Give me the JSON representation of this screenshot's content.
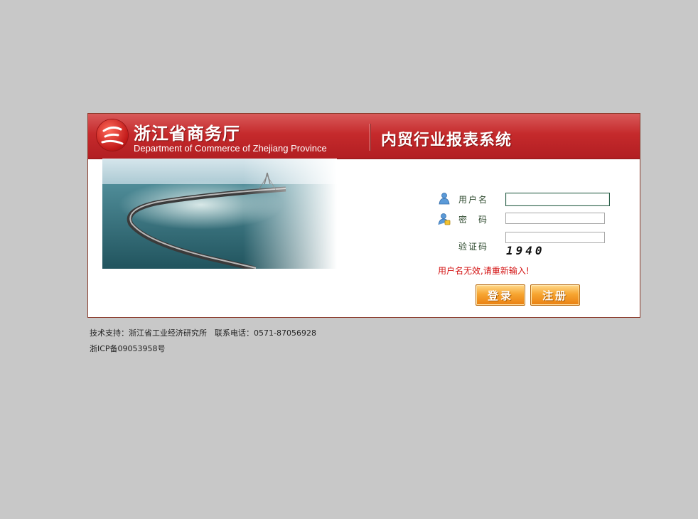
{
  "header": {
    "dept_cn": "浙江省商务厅",
    "dept_en": "Department of Commerce of Zhejiang Province",
    "system_title": "内贸行业报表系统",
    "brand_color": "#c52a2c"
  },
  "form": {
    "username_label": "用户名",
    "username_value": "",
    "password_label": "密　码",
    "password_value": "",
    "captcha_label": "验证码",
    "captcha_value": "",
    "captcha_image_text": "1940",
    "error_message": "用户名无效,请重新输入!",
    "login_button": "登录",
    "register_button": "注册",
    "error_color": "#d41414"
  },
  "footer": {
    "support": "技术支持：浙江省工业经济研究所　联系电话：0571-87056928",
    "icp": "浙ICP备09053958号"
  },
  "icons": {
    "username": "user-icon",
    "password": "user-lock-icon"
  }
}
